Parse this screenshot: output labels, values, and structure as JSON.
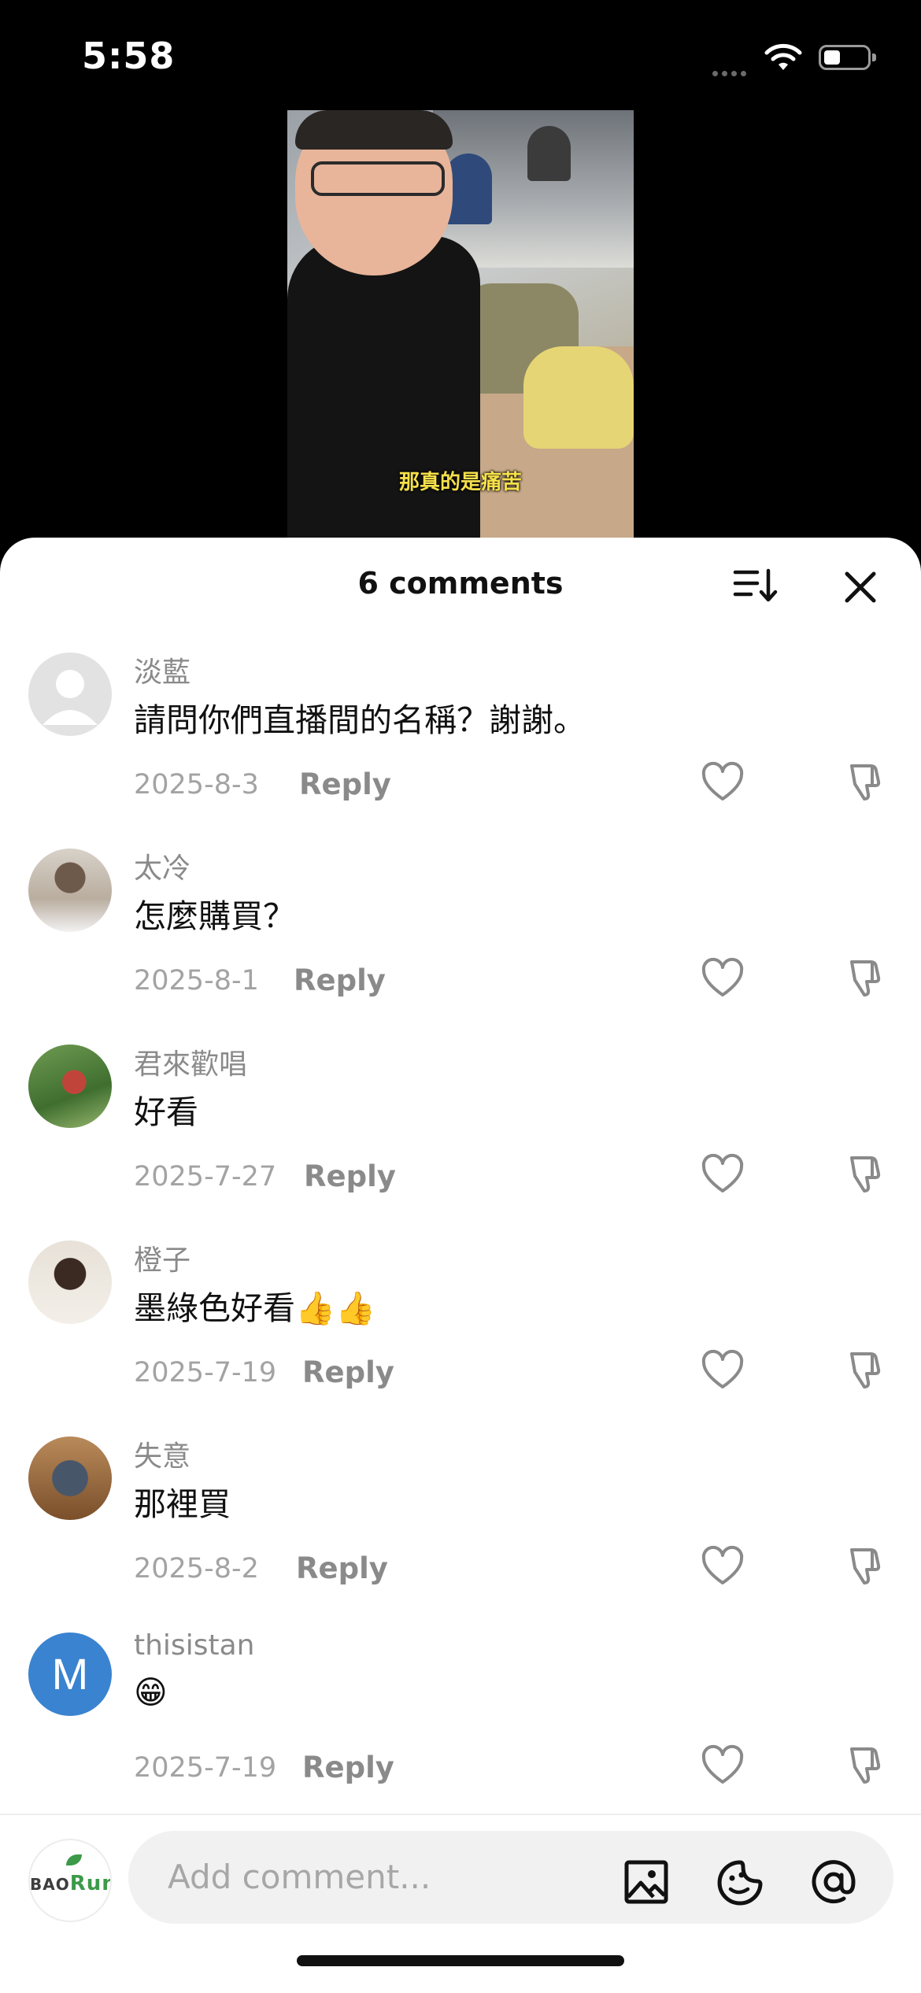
{
  "status_bar": {
    "time": "5:58"
  },
  "video": {
    "subtitle": "那真的是痛苦"
  },
  "comments_header": {
    "count_label": "6 comments"
  },
  "comments": [
    {
      "username": "淡藍",
      "text": "請問你們直播間的名稱？謝謝。",
      "date": "2025-8-3",
      "reply": "Reply",
      "avatar": "default-avatar"
    },
    {
      "username": "太冷",
      "text": "怎麼購買？",
      "date": "2025-8-1",
      "reply": "Reply",
      "avatar": "photo-avatar"
    },
    {
      "username": "君來歡唱",
      "text": "好看",
      "date": "2025-7-27",
      "reply": "Reply",
      "avatar": "photo-avatar"
    },
    {
      "username": "橙子",
      "text": "墨綠色好看👍👍",
      "date": "2025-7-19",
      "reply": "Reply",
      "avatar": "photo-avatar"
    },
    {
      "username": "失意",
      "text": "那裡買",
      "date": "2025-8-2",
      "reply": "Reply",
      "avatar": "photo-avatar"
    },
    {
      "username": "thisistan",
      "text": "😁",
      "date": "2025-7-19",
      "reply": "Reply",
      "avatar_letter": "M"
    }
  ],
  "composer": {
    "placeholder": "Add comment...",
    "avatar_brand": {
      "part1": "BAO",
      "part2": "Run"
    }
  },
  "colors": {
    "avatar_m": "#3a83d0",
    "subtitle": "#f6e04a"
  }
}
